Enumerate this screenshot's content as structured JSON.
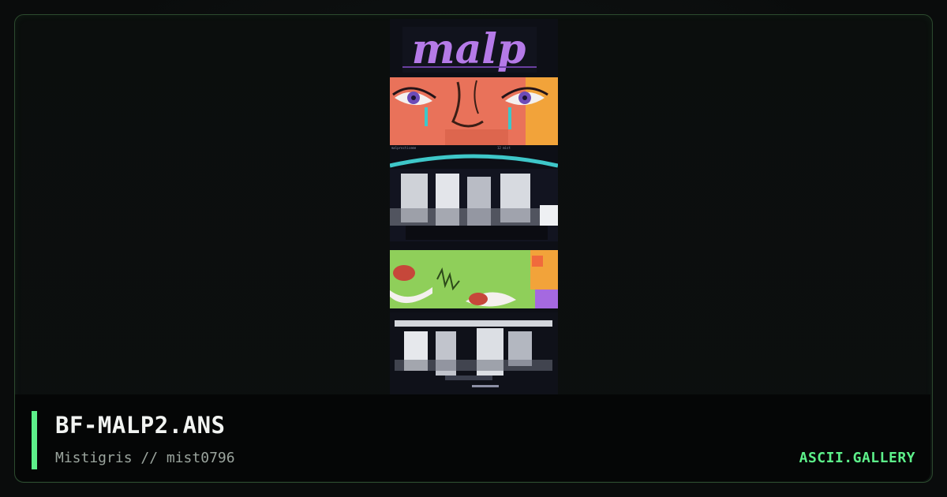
{
  "card": {
    "filename": "BF-MALP2.ANS",
    "credit": "Mistigris // mist0796",
    "brand": "ASCII.GALLERY"
  },
  "artwork": {
    "logo_text": "malp",
    "caption_left": "malprocticeme",
    "caption_right": "12 mist",
    "colors": {
      "logo_purple": "#b57ae8",
      "face_salmon": "#e9725a",
      "hair_orange": "#f2a33a",
      "teal_line": "#3ec7c9",
      "slime_green": "#8fcf5a",
      "eye_red": "#c6473a",
      "lilac": "#a569e0",
      "accent_green": "#5df08a"
    }
  }
}
